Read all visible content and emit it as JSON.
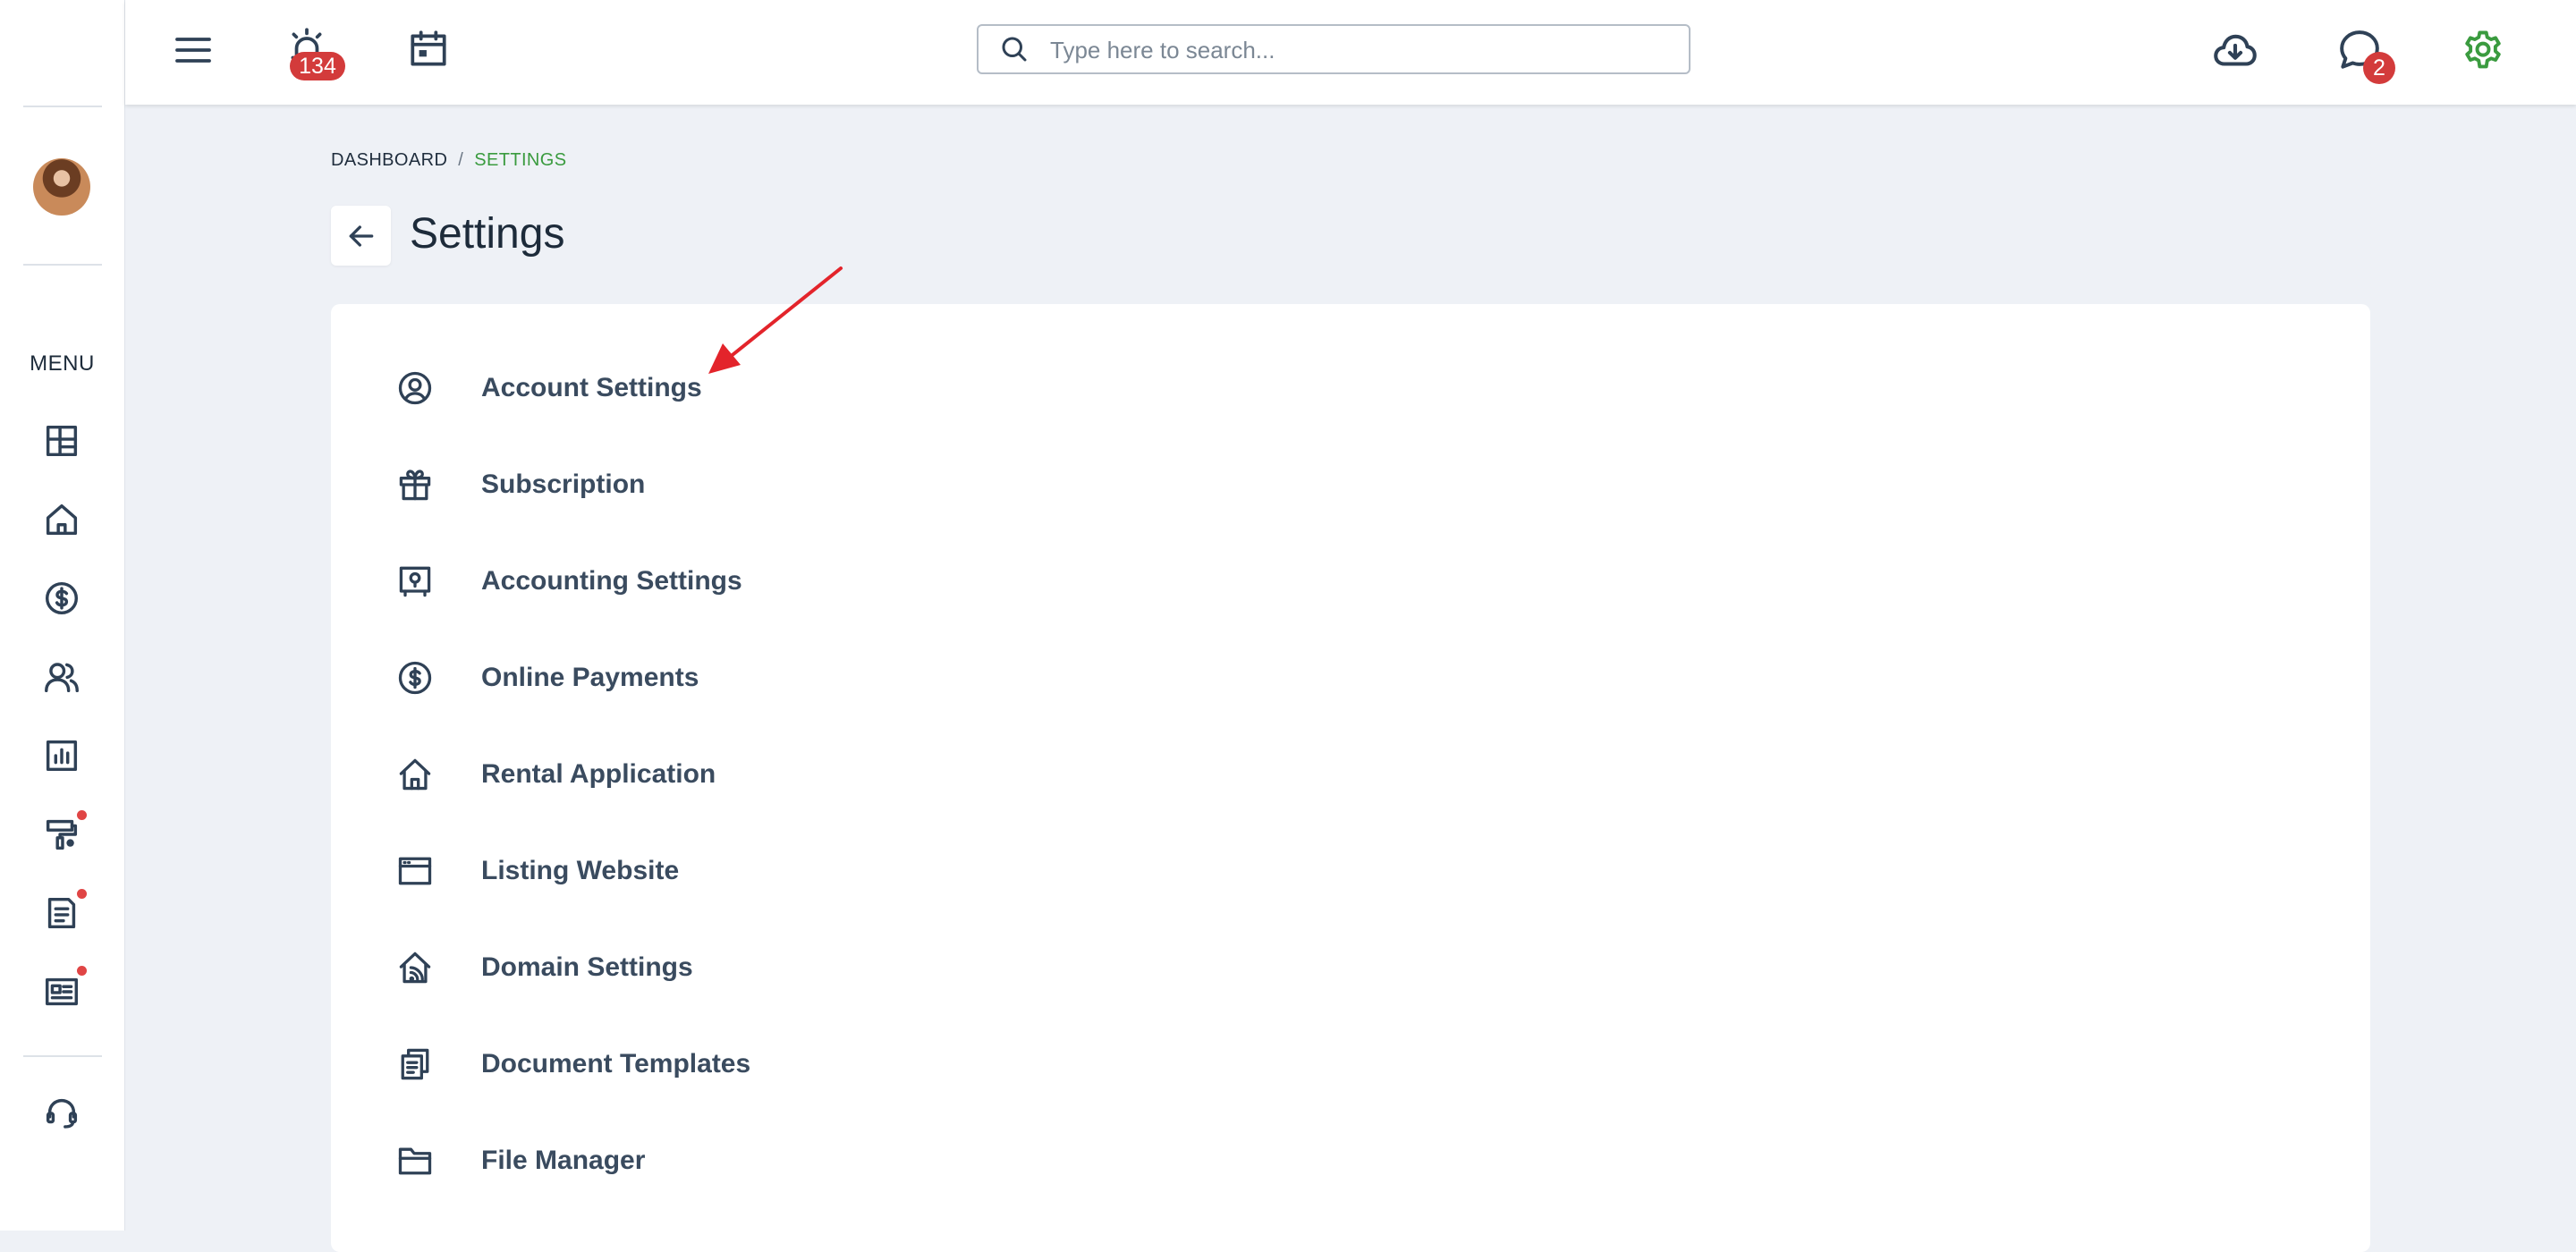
{
  "topbar": {
    "alarm_badge": "134",
    "messages_badge": "2",
    "search_placeholder": "Type here to search...",
    "accent_color": "#3a9b3f",
    "badge_color": "#d33b3b"
  },
  "sidebar": {
    "menu_label": "MENU",
    "items": [
      {
        "icon": "dashboard-icon"
      },
      {
        "icon": "home-icon"
      },
      {
        "icon": "dollar-icon"
      },
      {
        "icon": "users-icon"
      },
      {
        "icon": "reports-icon"
      },
      {
        "icon": "maintenance-icon",
        "dot": true
      },
      {
        "icon": "document-icon",
        "dot": true
      },
      {
        "icon": "listing-icon",
        "dot": true
      }
    ],
    "support_icon": "headset-icon",
    "dot_color": "#e04545"
  },
  "breadcrumb": {
    "dashboard": "DASHBOARD",
    "separator": "/",
    "current": "SETTINGS"
  },
  "page": {
    "title": "Settings"
  },
  "settings": {
    "items": [
      {
        "label": "Account Settings",
        "icon": "user-circle-icon"
      },
      {
        "label": "Subscription",
        "icon": "gift-icon"
      },
      {
        "label": "Accounting Settings",
        "icon": "safe-icon"
      },
      {
        "label": "Online Payments",
        "icon": "dollar-circle-icon"
      },
      {
        "label": "Rental Application",
        "icon": "house-icon"
      },
      {
        "label": "Listing Website",
        "icon": "browser-window-icon"
      },
      {
        "label": "Domain Settings",
        "icon": "house-signal-icon"
      },
      {
        "label": "Document Templates",
        "icon": "documents-icon"
      },
      {
        "label": "File Manager",
        "icon": "folder-icon"
      }
    ]
  },
  "annotation": {
    "arrow_color": "#e3242b"
  }
}
